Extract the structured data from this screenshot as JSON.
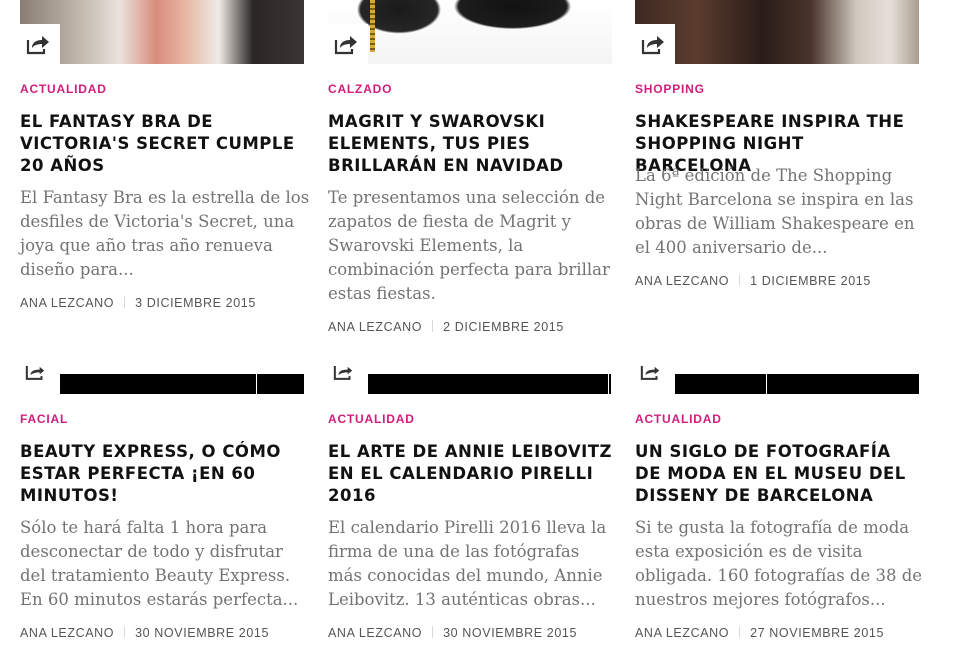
{
  "articles": [
    {
      "category": "ACTUALIDAD",
      "title": "EL FANTASY BRA DE VICTORIA'S SECRET CUMPLE 20 AÑOS",
      "excerpt": "El Fantasy Bra es la estrella de los desfiles de Victoria's Secret, una joya que año tras año renueva diseño para...",
      "author": "ANA LEZCANO",
      "date": "3 DICIEMBRE 2015",
      "icon": "share-icon"
    },
    {
      "category": "CALZADO",
      "title": "MAGRIT Y SWAROVSKI ELEMENTS, TUS PIES BRILLARÁN EN NAVIDAD",
      "excerpt": "Te presentamos una selección de zapatos de fiesta de Magrit y Swarovski Elements, la combinación perfecta para brillar estas fiestas.",
      "author": "ANA LEZCANO",
      "date": "2 DICIEMBRE 2015",
      "icon": "share-icon"
    },
    {
      "category": "SHOPPING",
      "title": "SHAKESPEARE INSPIRA THE SHOPPING NIGHT BARCELONA",
      "excerpt": "La 6ª edición de The Shopping Night Barcelona se inspira en las obras de William Shakespeare en el 400 aniversario de...",
      "author": "ANA LEZCANO",
      "date": "1 DICIEMBRE 2015",
      "icon": "share-icon"
    },
    {
      "category": "FACIAL",
      "title": "BEAUTY EXPRESS, O CÓMO ESTAR PERFECTA ¡EN 60 MINUTOS!",
      "excerpt": "Sólo te hará falta 1 hora para desconectar de todo y disfrutar del tratamiento Beauty Express. En 60 minutos estarás perfecta...",
      "author": "ANA LEZCANO",
      "date": "30 NOVIEMBRE 2015",
      "icon": "share-icon"
    },
    {
      "category": "ACTUALIDAD",
      "title": "EL ARTE DE ANNIE LEIBOVITZ EN EL CALENDARIO PIRELLI 2016",
      "excerpt": "El calendario Pirelli 2016 lleva la firma de una de las fotógrafas más conocidas del mundo, Annie Leibovitz. 13 auténticas obras...",
      "author": "ANA LEZCANO",
      "date": "30 NOVIEMBRE 2015",
      "icon": "share-icon"
    },
    {
      "category": "ACTUALIDAD",
      "title": "UN SIGLO DE FOTOGRAFÍA DE MODA EN EL MUSEU DEL DISSENY DE BARCELONA",
      "excerpt": "Si te gusta la fotografía de moda esta exposición es de visita obligada. 160 fotografías de 38 de nuestros mejores fotógrafos...",
      "author": "ANA LEZCANO",
      "date": "27 NOVIEMBRE 2015",
      "icon": "share-icon"
    }
  ],
  "colors": {
    "category": "#d11d7b",
    "title": "#111111",
    "excerpt": "#737373",
    "meta": "#555555"
  }
}
